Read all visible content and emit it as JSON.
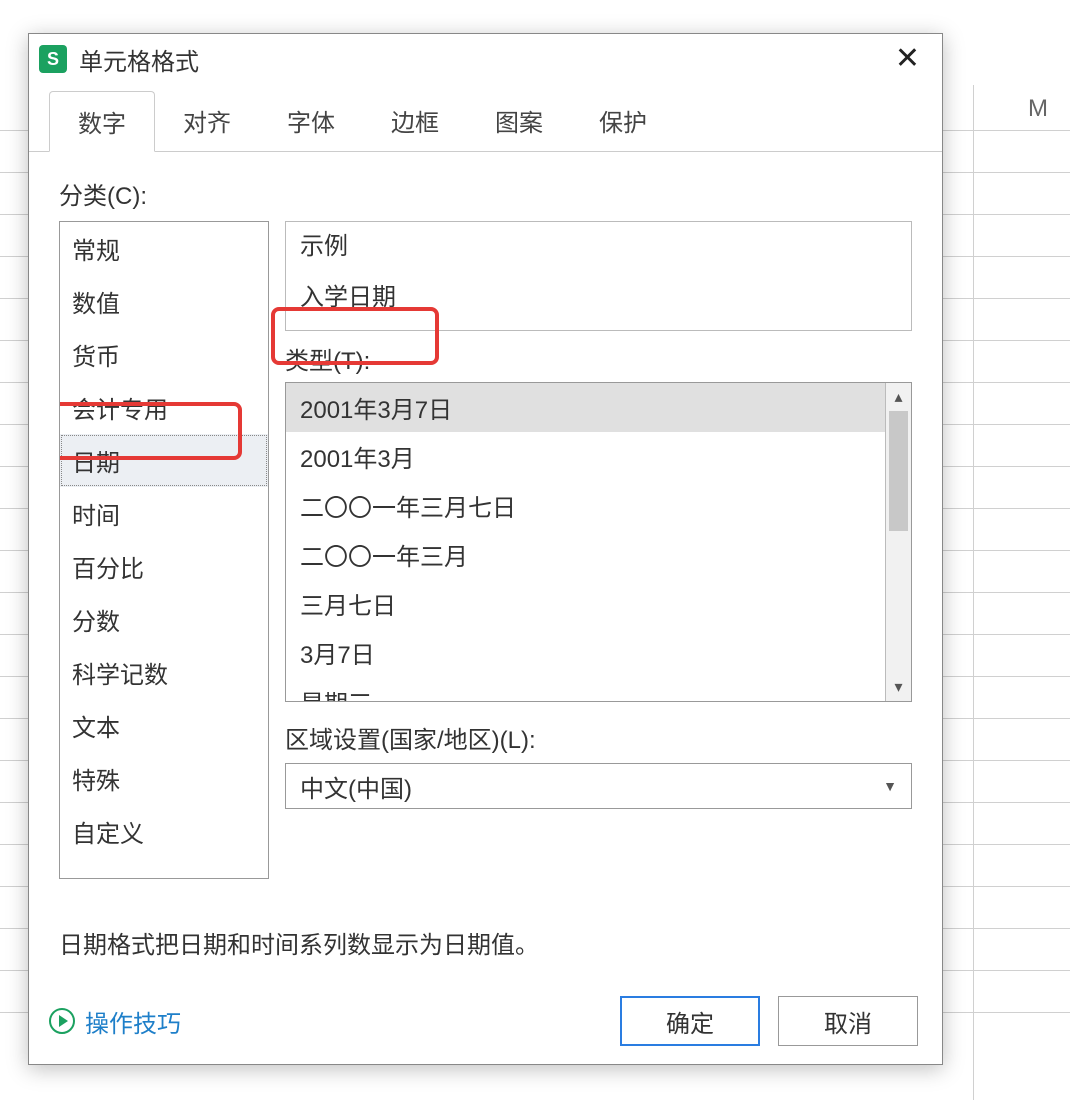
{
  "background": {
    "col_header_m": "M"
  },
  "dialog": {
    "app_icon_letter": "S",
    "title": "单元格格式"
  },
  "tabs": [
    "数字",
    "对齐",
    "字体",
    "边框",
    "图案",
    "保护"
  ],
  "active_tab_index": 0,
  "category_label": "分类(C):",
  "categories": [
    "常规",
    "数值",
    "货币",
    "会计专用",
    "日期",
    "时间",
    "百分比",
    "分数",
    "科学记数",
    "文本",
    "特殊",
    "自定义"
  ],
  "selected_category_index": 4,
  "example": {
    "label": "示例",
    "value": "入学日期"
  },
  "type_label": "类型(T):",
  "types": [
    "2001年3月7日",
    "2001年3月",
    "二〇〇一年三月七日",
    "二〇〇一年三月",
    "三月七日",
    "3月7日",
    "星期三"
  ],
  "selected_type_index": 0,
  "locale": {
    "label": "区域设置(国家/地区)(L):",
    "value": "中文(中国)"
  },
  "description": "日期格式把日期和时间系列数显示为日期值。",
  "tips_label": "操作技巧",
  "buttons": {
    "ok": "确定",
    "cancel": "取消"
  }
}
